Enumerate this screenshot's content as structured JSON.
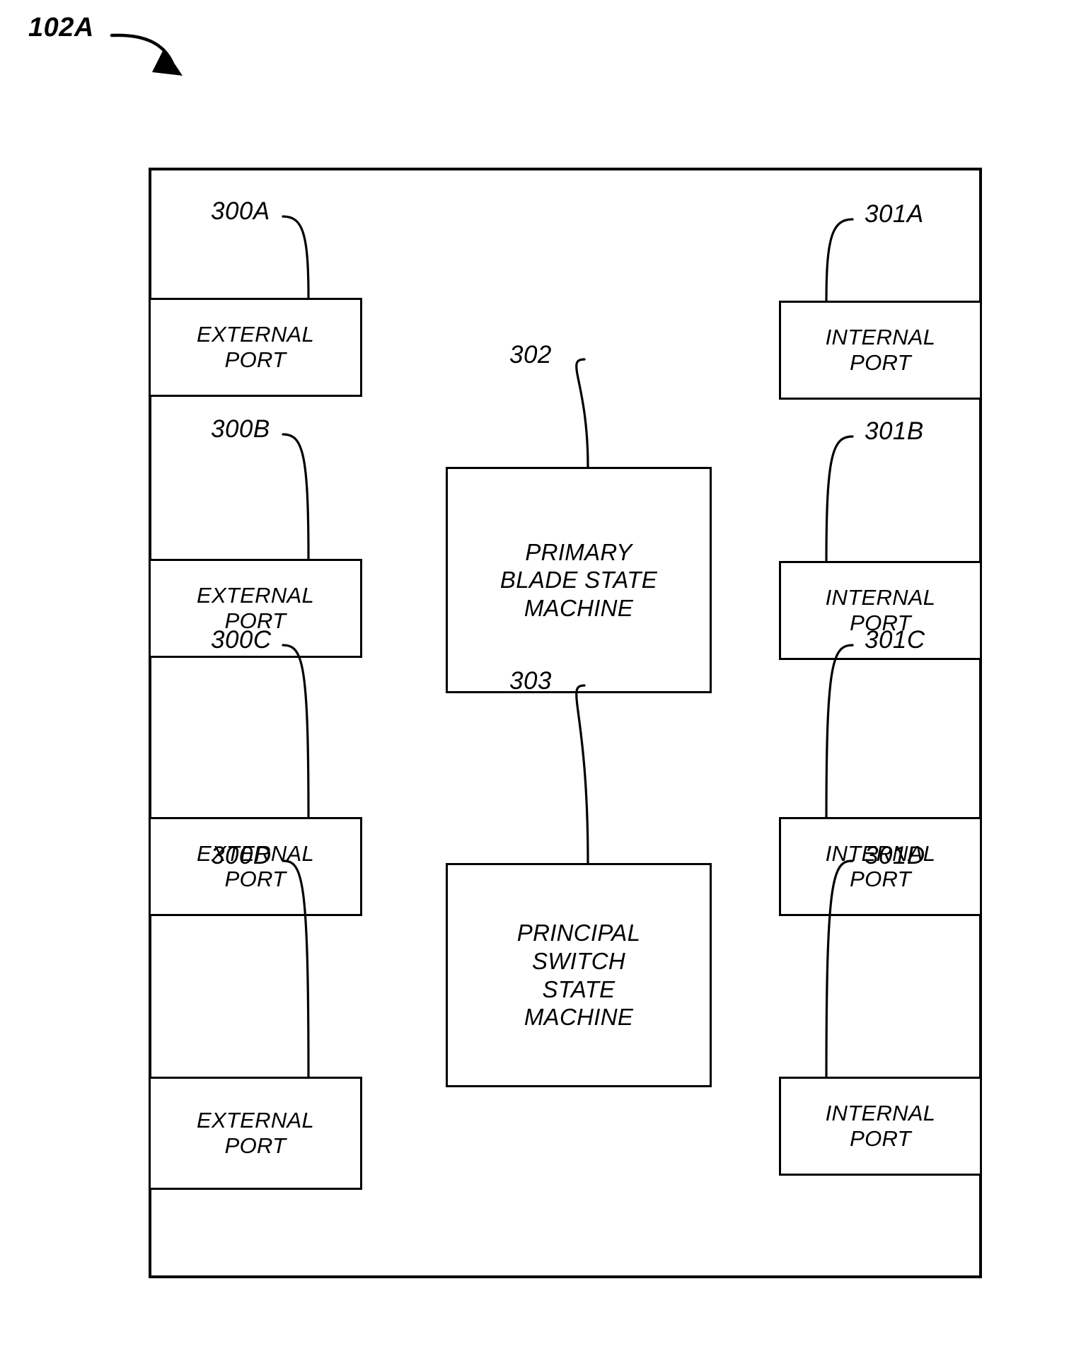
{
  "figure": {
    "tag": "102A",
    "description": "Blade switch block diagram with external ports, internal ports and two state machines"
  },
  "chassis": {
    "name": "blade-switch-chassis"
  },
  "external_ports": [
    {
      "ref": "300A",
      "label": "EXTERNAL\nPORT"
    },
    {
      "ref": "300B",
      "label": "EXTERNAL\nPORT"
    },
    {
      "ref": "300C",
      "label": "EXTERNAL\nPORT"
    },
    {
      "ref": "300D",
      "label": "EXTERNAL\nPORT"
    }
  ],
  "internal_ports": [
    {
      "ref": "301A",
      "label": "INTERNAL\nPORT"
    },
    {
      "ref": "301B",
      "label": "INTERNAL\nPORT"
    },
    {
      "ref": "301C",
      "label": "INTERNAL\nPORT"
    },
    {
      "ref": "301D",
      "label": "INTERNAL\nPORT"
    }
  ],
  "state_machines": [
    {
      "ref": "302",
      "label": "PRIMARY\nBLADE STATE\nMACHINE"
    },
    {
      "ref": "303",
      "label": "PRINCIPAL\nSWITCH\nSTATE\nMACHINE"
    }
  ],
  "colors": {
    "ink": "#000000",
    "paper": "#ffffff"
  }
}
